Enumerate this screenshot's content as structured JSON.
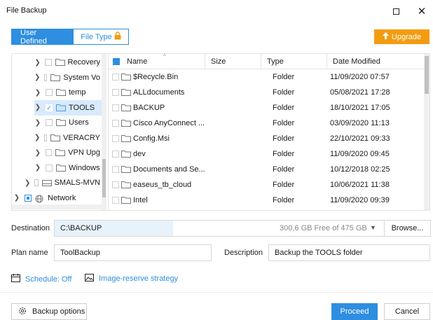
{
  "window": {
    "title": "File Backup",
    "maximize_icon": "maximize-icon",
    "close_icon": "close-icon"
  },
  "tabs": [
    {
      "label": "User Defined",
      "active": true
    },
    {
      "label": "File Type",
      "active": false,
      "icon": "lock-icon",
      "icon_color": "#f39c12"
    }
  ],
  "upgrade": {
    "label": "Upgrade",
    "icon": "arrow-up-icon",
    "color": "#f39c12"
  },
  "tree": {
    "items": [
      {
        "label": "Recovery",
        "expanded": false,
        "state": "unchecked"
      },
      {
        "label": "System Vo",
        "expanded": false,
        "state": "unchecked"
      },
      {
        "label": "temp",
        "expanded": false,
        "state": "unchecked"
      },
      {
        "label": "TOOLS",
        "expanded": false,
        "state": "checked",
        "selected": true
      },
      {
        "label": "Users",
        "expanded": false,
        "state": "unchecked"
      },
      {
        "label": "VERACRY",
        "expanded": false,
        "state": "unchecked"
      },
      {
        "label": "VPN Upg",
        "expanded": false,
        "state": "unchecked"
      },
      {
        "label": "Windows",
        "expanded": false,
        "state": "unchecked"
      },
      {
        "label": "SMALS-MVN",
        "expanded": false,
        "state": "unchecked",
        "icon": "drive-icon"
      },
      {
        "label": "Network",
        "expanded": false,
        "state": "partial",
        "icon": "network-icon"
      }
    ]
  },
  "files": {
    "columns": {
      "name": "Name",
      "size": "Size",
      "type": "Type",
      "date": "Date Modified"
    },
    "rows": [
      {
        "name": "$Recycle.Bin",
        "size": "",
        "type": "Folder",
        "date": "11/09/2020 07:57"
      },
      {
        "name": "ALLdocuments",
        "size": "",
        "type": "Folder",
        "date": "05/08/2021 17:28"
      },
      {
        "name": "BACKUP",
        "size": "",
        "type": "Folder",
        "date": "18/10/2021 17:05"
      },
      {
        "name": "Cisco AnyConnect ...",
        "size": "",
        "type": "Folder",
        "date": "03/09/2020 11:13"
      },
      {
        "name": "Config.Msi",
        "size": "",
        "type": "Folder",
        "date": "22/10/2021 09:33"
      },
      {
        "name": "dev",
        "size": "",
        "type": "Folder",
        "date": "11/09/2020 09:45"
      },
      {
        "name": "Documents and Se...",
        "size": "",
        "type": "Folder",
        "date": "10/12/2018 02:25"
      },
      {
        "name": "easeus_tb_cloud",
        "size": "",
        "type": "Folder",
        "date": "10/06/2021 11:38"
      },
      {
        "name": "Intel",
        "size": "",
        "type": "Folder",
        "date": "11/09/2020 09:39"
      }
    ]
  },
  "destination": {
    "label": "Destination",
    "value": "C:\\BACKUP",
    "free_space": "300,6 GB Free of 475 GB",
    "browse_label": "Browse..."
  },
  "plan": {
    "label": "Plan name",
    "value": "ToolBackup"
  },
  "description": {
    "label": "Description",
    "value": "Backup the TOOLS folder"
  },
  "schedule": {
    "label": "Schedule: Off",
    "icon": "calendar-icon"
  },
  "image_reserve": {
    "label": "Image-reserve strategy",
    "icon": "image-icon"
  },
  "footer": {
    "backup_options_label": "Backup options",
    "backup_options_icon": "gear-icon",
    "proceed_label": "Proceed",
    "cancel_label": "Cancel"
  },
  "colors": {
    "accent": "#2e8ee0",
    "upgrade": "#f39c12",
    "selection": "#d8eafc"
  }
}
